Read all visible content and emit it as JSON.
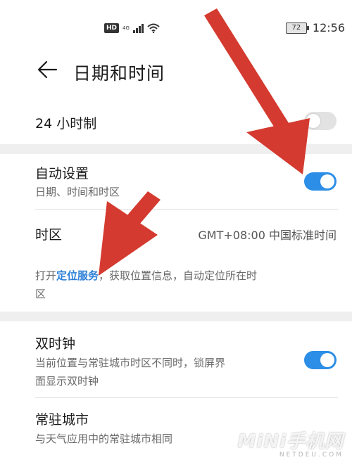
{
  "status_bar": {
    "hd_badge": "HD",
    "network": "4G",
    "battery": "72",
    "time": "12:56"
  },
  "header": {
    "title": "日期和时间"
  },
  "settings": {
    "hour24": {
      "label": "24 小时制",
      "enabled": false
    },
    "auto": {
      "label": "自动设置",
      "sub": "日期、时间和时区",
      "enabled": true
    },
    "timezone": {
      "label": "时区",
      "value": "GMT+08:00 中国标准时间",
      "hint_before": "打开",
      "hint_link": "定位服务",
      "hint_after": "，获取位置信息，自动定位所在时",
      "hint_line2": "区"
    },
    "dual_clock": {
      "label": "双时钟",
      "sub_line1": "当前位置与常驻城市时区不同时，锁屏界",
      "sub_line2": "面显示双时钟",
      "enabled": true
    },
    "home_city": {
      "label": "常驻城市",
      "sub": "与天气应用中的常驻城市相同"
    }
  },
  "watermark": {
    "main": "MiNi手机网",
    "sub": "NETDEU.COM"
  },
  "colors": {
    "accent": "#2c8ee6",
    "link": "#2c7fd6",
    "arrow": "#d43a2f"
  }
}
